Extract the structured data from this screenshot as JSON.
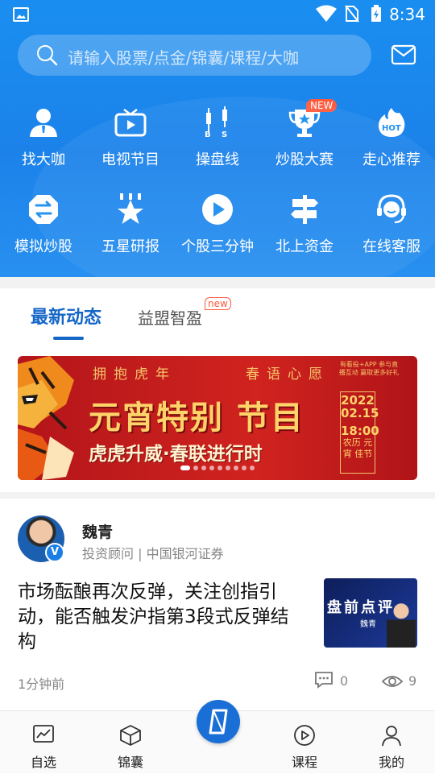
{
  "status_bar": {
    "time": "8:34"
  },
  "search": {
    "placeholder": "请输入股票/点金/锦囊/课程/大咖"
  },
  "menu": [
    {
      "label": "找大咖",
      "icon": "expert-icon"
    },
    {
      "label": "电视节目",
      "icon": "tv-icon"
    },
    {
      "label": "操盘线",
      "icon": "trading-line-icon"
    },
    {
      "label": "炒股大赛",
      "icon": "trophy-icon",
      "badge": "NEW"
    },
    {
      "label": "走心推荐",
      "icon": "hot-icon"
    },
    {
      "label": "模拟炒股",
      "icon": "simulate-icon"
    },
    {
      "label": "五星研报",
      "icon": "star-report-icon"
    },
    {
      "label": "个股三分钟",
      "icon": "play-icon"
    },
    {
      "label": "北上资金",
      "icon": "signpost-icon"
    },
    {
      "label": "在线客服",
      "icon": "headset-icon"
    }
  ],
  "tabs": {
    "active": "最新动态",
    "other": "益盟智盈",
    "other_tag": "new"
  },
  "banner": {
    "line1a": "拥抱虎年",
    "line1b": "春语心愿",
    "main": "元宵特别 节目",
    "sub": "虎虎升威·春联进行时",
    "corner": "有看投+APP 参与直播互动 赢取更多好礼",
    "date_year": "2022",
    "date_day": "02.15",
    "date_time": "18:00",
    "date_note": "农历 元宵 佳节",
    "slide_count": 9,
    "active_slide": 0
  },
  "post": {
    "author": "魏青",
    "subtitle": "投资顾问 | 中国银河证券",
    "title": "市场酝酿再次反弹，关注创指引动，能否触发沪指第3段式反弹结构",
    "thumb_title": "盘前点评",
    "thumb_name": "魏青",
    "time": "1分钟前",
    "comments": "0",
    "views": "9"
  },
  "nav": [
    {
      "label": "自选",
      "icon": "chart-icon"
    },
    {
      "label": "锦囊",
      "icon": "box-icon"
    },
    {
      "label": "",
      "icon": "home-logo-icon"
    },
    {
      "label": "课程",
      "icon": "play-circle-icon"
    },
    {
      "label": "我的",
      "icon": "user-icon"
    }
  ]
}
